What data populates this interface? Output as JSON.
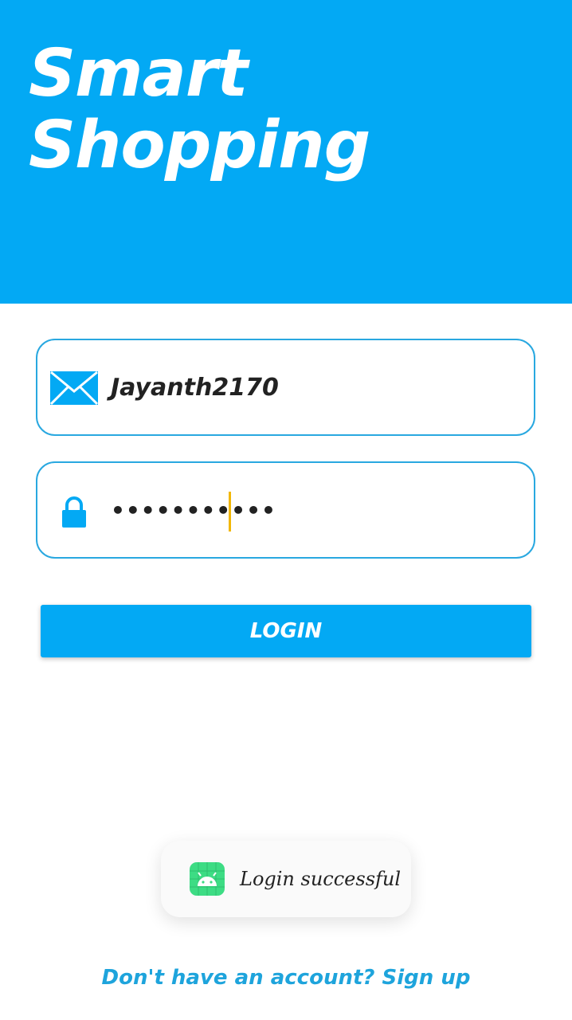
{
  "header": {
    "title_line1": "Smart",
    "title_line2": "Shopping"
  },
  "login_form": {
    "email_value": "Jayanth2170",
    "password_value": "•••••••••••",
    "email_icon": "envelope-icon",
    "password_icon": "lock-icon",
    "login_label": "LOGIN"
  },
  "toast": {
    "message": "Login successful",
    "icon": "android-app-icon"
  },
  "footer": {
    "signup_text": "Don't have an account? Sign up"
  },
  "colors": {
    "primary": "#03a9f4",
    "field_border": "#29a8e0",
    "cursor": "#f2b705",
    "link": "#1ea4dc",
    "toast_icon_bg": "#3ddc84"
  }
}
